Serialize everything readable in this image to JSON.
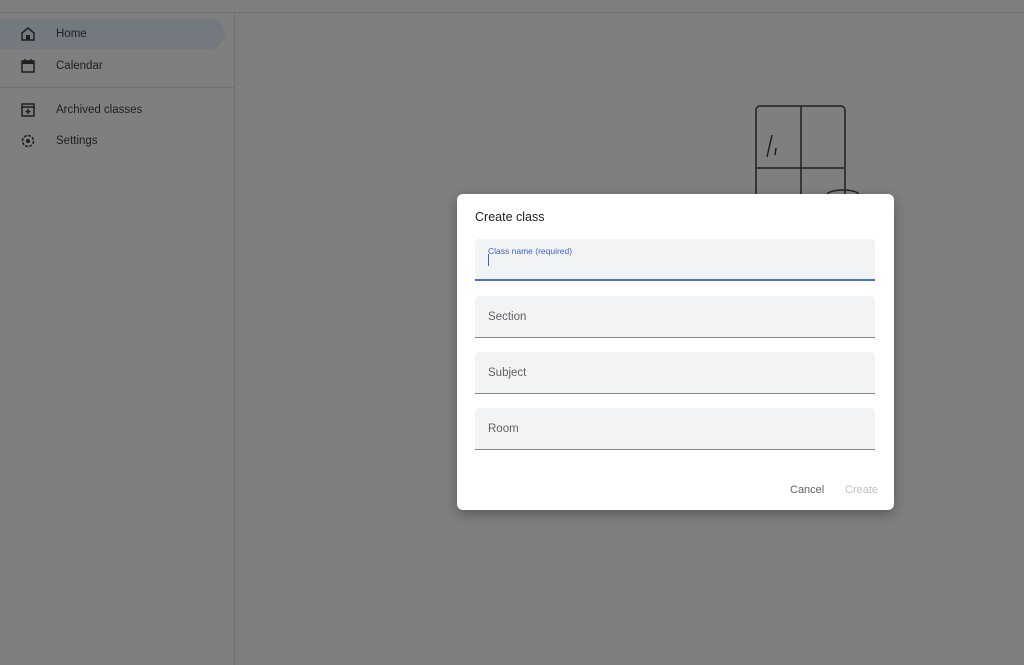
{
  "sidebar": {
    "items": [
      {
        "label": "Home",
        "icon": "home-icon",
        "active": true
      },
      {
        "label": "Calendar",
        "icon": "calendar-icon"
      },
      {
        "label": "Archived classes",
        "icon": "archive-icon"
      },
      {
        "label": "Settings",
        "icon": "gear-icon"
      }
    ]
  },
  "dialog": {
    "title": "Create class",
    "fields": [
      {
        "label": "Class name (required)",
        "value": ""
      },
      {
        "label": "Section",
        "value": ""
      },
      {
        "label": "Subject",
        "value": ""
      },
      {
        "label": "Room",
        "value": ""
      }
    ],
    "cancel_label": "Cancel",
    "create_label": "Create"
  },
  "colors": {
    "accent": "#4a72c8",
    "scrim": "#808080"
  }
}
